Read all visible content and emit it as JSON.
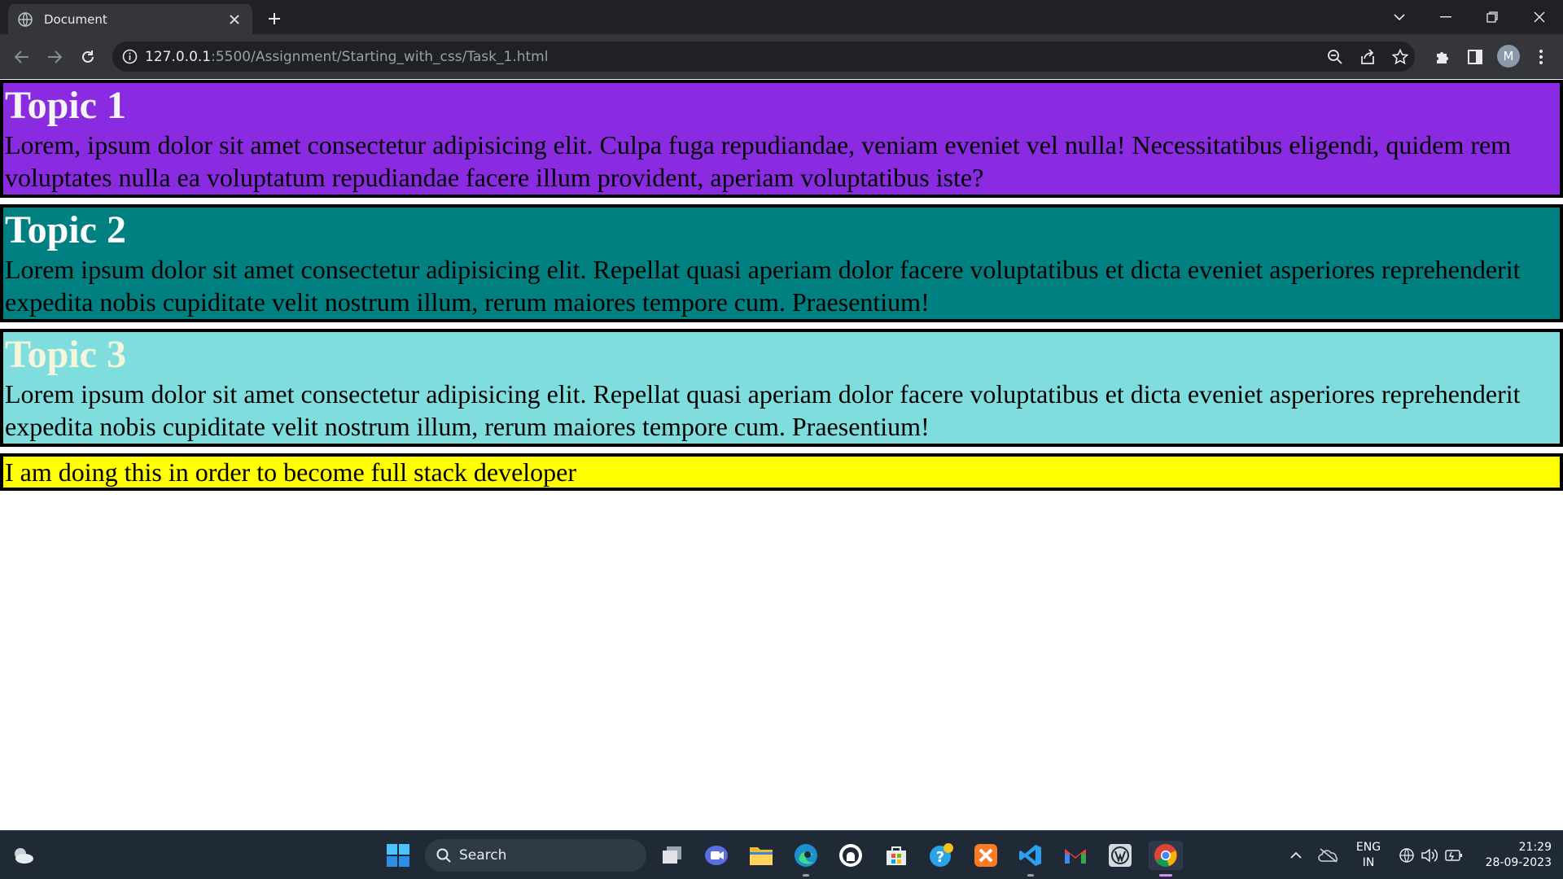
{
  "browser": {
    "tab_title": "Document",
    "url_host": "127.0.0.1",
    "url_path": ":5500/Assignment/Starting_with_css/Task_1.html",
    "profile_initial": "M"
  },
  "page": {
    "topics": [
      {
        "heading": "Topic 1",
        "text": "Lorem, ipsum dolor sit amet consectetur adipisicing elit. Culpa fuga repudiandae, veniam eveniet vel nulla! Necessitatibus eligendi, quidem rem voluptates nulla ea voluptatum repudiandae facere illum provident, aperiam voluptatibus iste?",
        "bg": "#8a2be2"
      },
      {
        "heading": "Topic 2",
        "text": "Lorem ipsum dolor sit amet consectetur adipisicing elit. Repellat quasi aperiam dolor facere voluptatibus et dicta eveniet asperiores reprehenderit expedita nobis cupiditate velit nostrum illum, rerum maiores tempore cum. Praesentium!",
        "bg": "#008080"
      },
      {
        "heading": "Topic 3",
        "text": "Lorem ipsum dolor sit amet consectetur adipisicing elit. Repellat quasi aperiam dolor facere voluptatibus et dicta eveniet asperiores reprehenderit expedita nobis cupiditate velit nostrum illum, rerum maiores tempore cum. Praesentium!",
        "bg": "#7fdddd"
      }
    ],
    "note": {
      "text": "I am doing this in order to become full stack developer",
      "bg": "#ffff00"
    }
  },
  "taskbar": {
    "search_label": "Search",
    "language": "ENG",
    "region": "IN",
    "time": "21:29",
    "date": "28-09-2023",
    "pinned_icons": [
      "task-view-icon",
      "meet-icon",
      "file-explorer-icon",
      "edge-icon",
      "github-icon",
      "store-icon",
      "help-icon",
      "xampp-icon",
      "vscode-icon",
      "gmail-icon",
      "wordpress-icon",
      "chrome-icon"
    ]
  }
}
